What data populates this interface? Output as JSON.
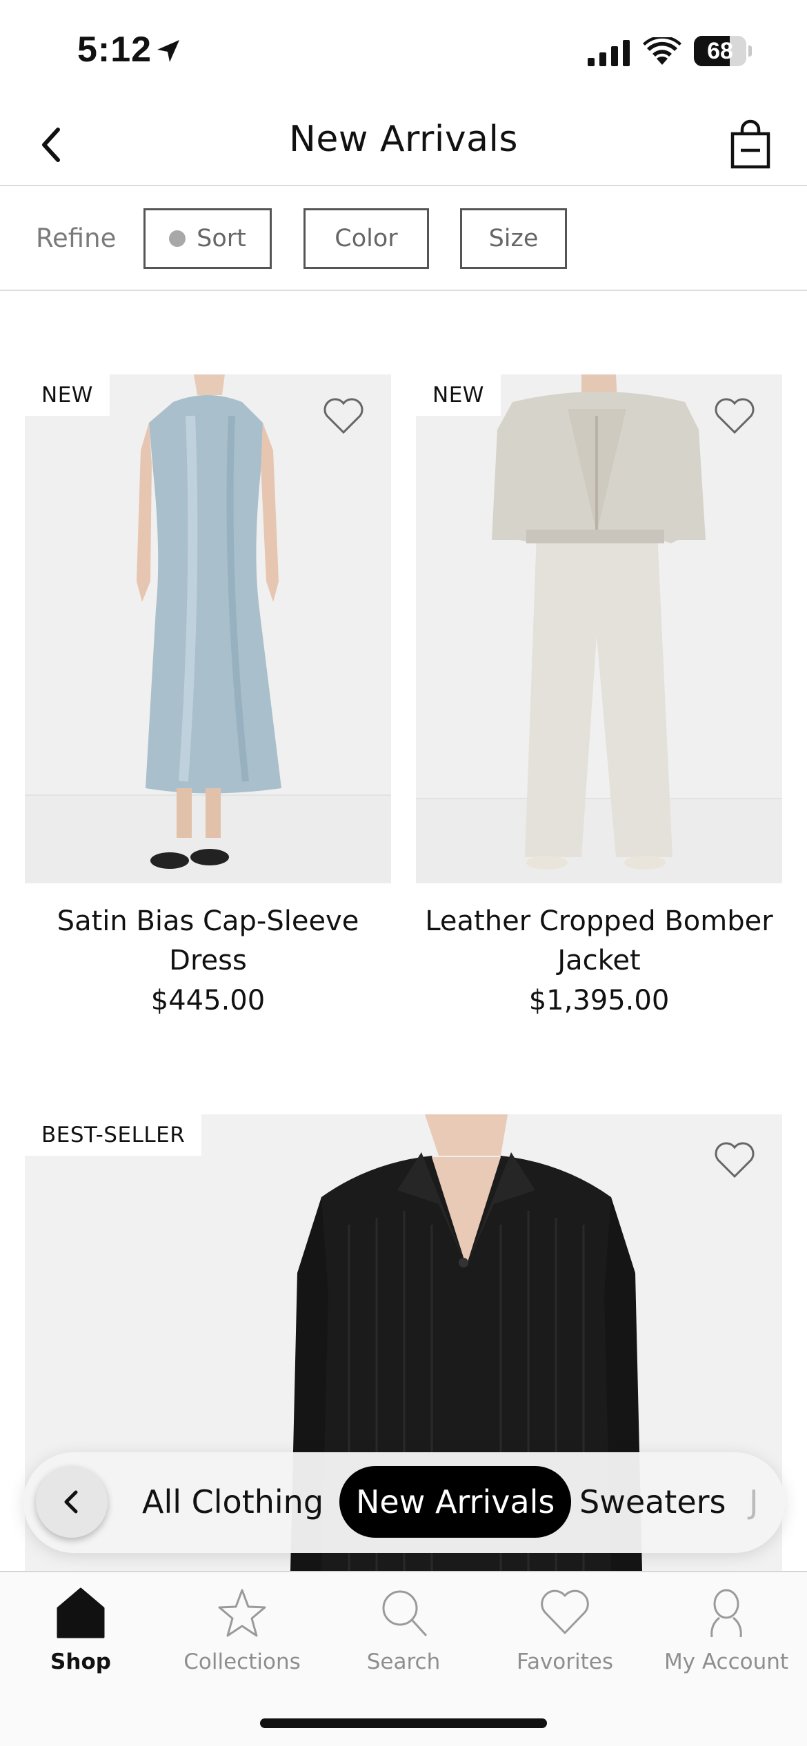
{
  "status_bar": {
    "time": "5:12",
    "battery": "68",
    "battery_level": 0.68
  },
  "header": {
    "title": "New Arrivals"
  },
  "refine": {
    "label": "Refine",
    "filters": [
      "Sort",
      "Color",
      "Size"
    ]
  },
  "products": [
    {
      "badge": "NEW",
      "name": "Satin Bias Cap-Sleeve Dress",
      "price": "$445.00"
    },
    {
      "badge": "NEW",
      "name": "Leather Cropped Bomber Jacket",
      "price": "$1,395.00"
    },
    {
      "badge": "BEST-SELLER",
      "name": "",
      "price": ""
    }
  ],
  "categories": {
    "items": [
      "All Clothing",
      "New Arrivals",
      "Sweaters",
      "J"
    ],
    "active": "New Arrivals"
  },
  "tab_bar": {
    "items": [
      "Shop",
      "Collections",
      "Search",
      "Favorites",
      "My Account"
    ],
    "active": "Shop"
  },
  "colors": {
    "accent": "#000000",
    "inactive_tab": "#8e8e8e",
    "image_bg": "#f0f0f0"
  }
}
